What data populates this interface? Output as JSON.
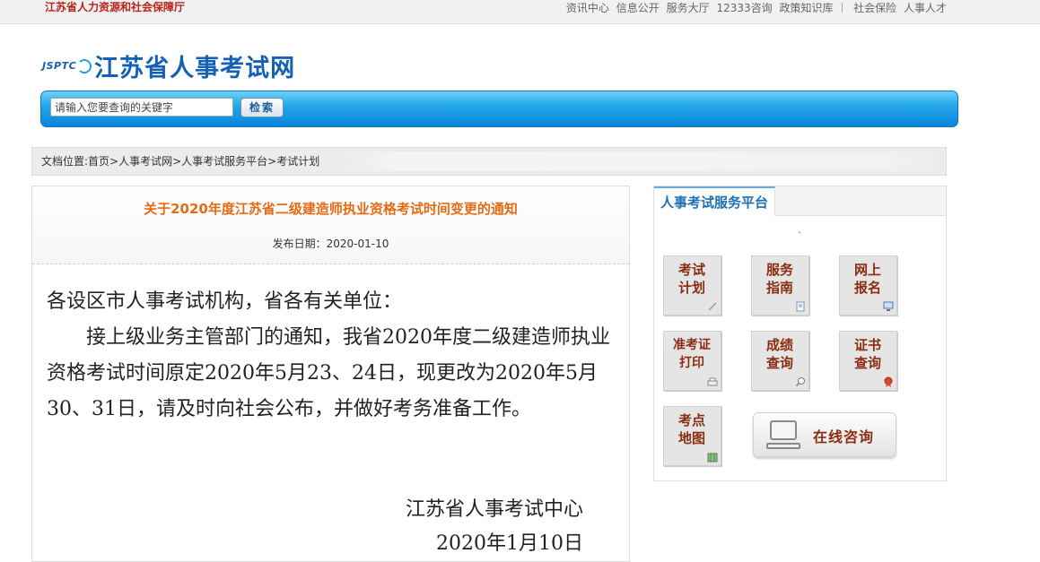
{
  "topbar": {
    "org_name": "江苏省人力资源和社会保障厅",
    "links": [
      "资讯中心",
      "信息公开",
      "服务大厅",
      "12333咨询",
      "政策知识库"
    ],
    "links_right": [
      "社会保险",
      "人事人才"
    ]
  },
  "logo": {
    "abbr": "JSPTC",
    "name": "江苏省人事考试网"
  },
  "search": {
    "placeholder": "请输入您要查询的关键字",
    "button_label": "检索"
  },
  "breadcrumb": {
    "text": "文档位置:首页>人事考试网>人事考试服务平台>考试计划"
  },
  "article": {
    "title": "关于2020年度江苏省二级建造师执业资格考试时间变更的通知",
    "date": "发布日期：2020-01-10",
    "salutation": "各设区市人事考试机构，省各有关单位：",
    "paragraph": "接上级业务主管部门的通知，我省2020年度二级建造师执业资格考试时间原定2020年5月23、24日，现更改为2020年5月30、31日，请及时向社会公布，并做好考务准备工作。",
    "signature_org": "江苏省人事考试中心",
    "signature_date": "2020年1月10日"
  },
  "sidebar": {
    "tab_title": "人事考试服务平台",
    "mark": "`",
    "tiles": [
      {
        "line1": "考试",
        "line2": "计划",
        "icon": "pen-icon"
      },
      {
        "line1": "服务",
        "line2": "指南",
        "icon": "document-icon"
      },
      {
        "line1": "网上",
        "line2": "报名",
        "icon": "monitor-icon"
      },
      {
        "line1": "准考证",
        "line2": "打印",
        "icon": "printer-icon"
      },
      {
        "line1": "成绩",
        "line2": "查询",
        "icon": "magnifier-icon"
      },
      {
        "line1": "证书",
        "line2": "查询",
        "icon": "seal-icon"
      },
      {
        "line1": "考点",
        "line2": "地图",
        "icon": "map-icon"
      }
    ],
    "consult_label": "在线咨询"
  }
}
